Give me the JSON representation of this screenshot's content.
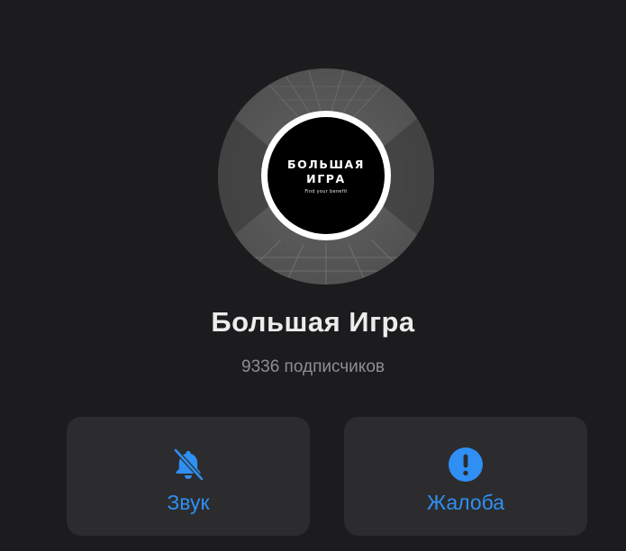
{
  "channel": {
    "logo_line1": "БОЛЬШАЯ",
    "logo_line2": "ИГРА",
    "logo_tagline": "Find your benefit",
    "title": "Большая Игра",
    "subscribers": "9336 подписчиков"
  },
  "actions": [
    {
      "label": "Звук",
      "icon": "bell-slash-icon"
    },
    {
      "label": "Жалоба",
      "icon": "exclamation-circle-icon"
    }
  ],
  "colors": {
    "background": "#1c1c1e",
    "button_background": "#2c2c2e",
    "accent": "#2f8ff3",
    "title": "#ececec",
    "subtitle": "#8e8e93"
  }
}
